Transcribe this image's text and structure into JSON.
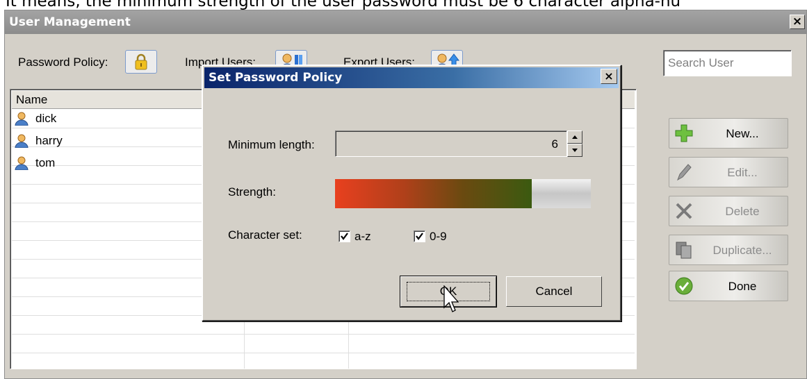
{
  "caption": "It means, the minimum strength of the user password must be 6 character alpha-nu",
  "window": {
    "title": "User Management",
    "close_label": "×"
  },
  "toolbar": {
    "password_policy_label": "Password Policy:",
    "import_users_label": "Import Users:",
    "export_users_label": "Export Users:",
    "search_placeholder": "Search User"
  },
  "table": {
    "columns": [
      "Name",
      "",
      ""
    ],
    "rows": [
      "dick",
      "harry",
      "tom"
    ]
  },
  "side_buttons": {
    "new": "New...",
    "edit": "Edit...",
    "delete": "Delete",
    "duplicate": "Duplicate...",
    "done": "Done"
  },
  "dialog": {
    "title": "Set Password Policy",
    "close_label": "×",
    "min_length_label": "Minimum length:",
    "min_length_value": "6",
    "strength_label": "Strength:",
    "strength_level": 0.77,
    "charset_label": "Character set:",
    "charset_az_label": "a-z",
    "charset_az_checked": true,
    "charset_09_label": "0-9",
    "charset_09_checked": true,
    "ok_label": "OK",
    "cancel_label": "Cancel"
  },
  "colors": {
    "dialog_title_start": "#0a246a",
    "dialog_title_end": "#a6caf0",
    "strength_start": "#e8401f",
    "strength_end": "#3b5a10",
    "window_title": "#8c8c8c"
  },
  "icons": {
    "password_policy": "lock-icon",
    "import_users": "user-import-icon",
    "export_users": "user-export-icon",
    "user": "user-icon",
    "new": "plus-icon",
    "edit": "pencil-icon",
    "delete": "x-icon",
    "duplicate": "duplicate-icon",
    "done": "checkmark-icon",
    "cursor": "arrow-cursor-icon"
  }
}
